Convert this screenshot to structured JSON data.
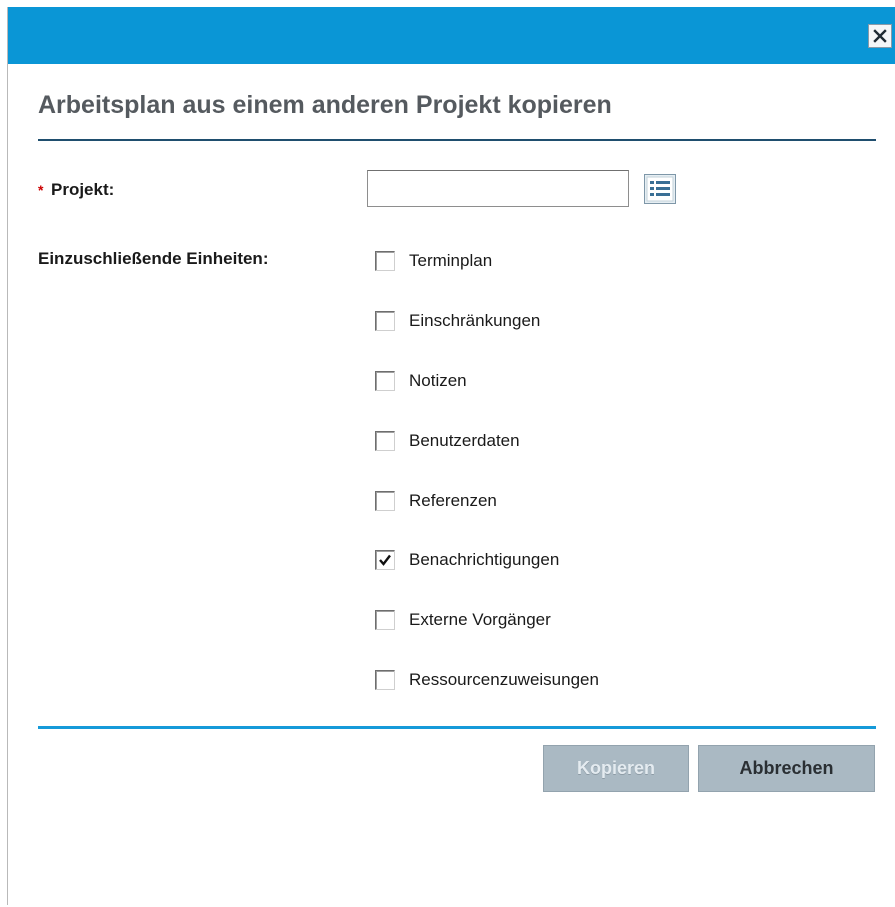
{
  "dialog": {
    "title": "Arbeitsplan aus einem anderen Projekt kopieren",
    "close_icon": "close-x-icon"
  },
  "project": {
    "required_marker": "*",
    "label": "Projekt:",
    "value": "",
    "placeholder": "",
    "picker_icon": "list-picker-icon"
  },
  "units": {
    "label": "Einzuschließende Einheiten:",
    "options": [
      {
        "label": "Terminplan",
        "checked": false
      },
      {
        "label": "Einschränkungen",
        "checked": false
      },
      {
        "label": "Notizen",
        "checked": false
      },
      {
        "label": "Benutzerdaten",
        "checked": false
      },
      {
        "label": "Referenzen",
        "checked": false
      },
      {
        "label": "Benachrichtigungen",
        "checked": true
      },
      {
        "label": "Externe Vorgänger",
        "checked": false
      },
      {
        "label": "Ressourcenzuweisungen",
        "checked": false
      }
    ]
  },
  "actions": {
    "copy_label": "Kopieren",
    "copy_enabled": false,
    "cancel_label": "Abbrechen"
  },
  "colors": {
    "titlebar": "#0a96d6",
    "heading_rule": "#1f4e6e",
    "footer_rule": "#159ad9",
    "button_bg": "#aab9c3"
  }
}
